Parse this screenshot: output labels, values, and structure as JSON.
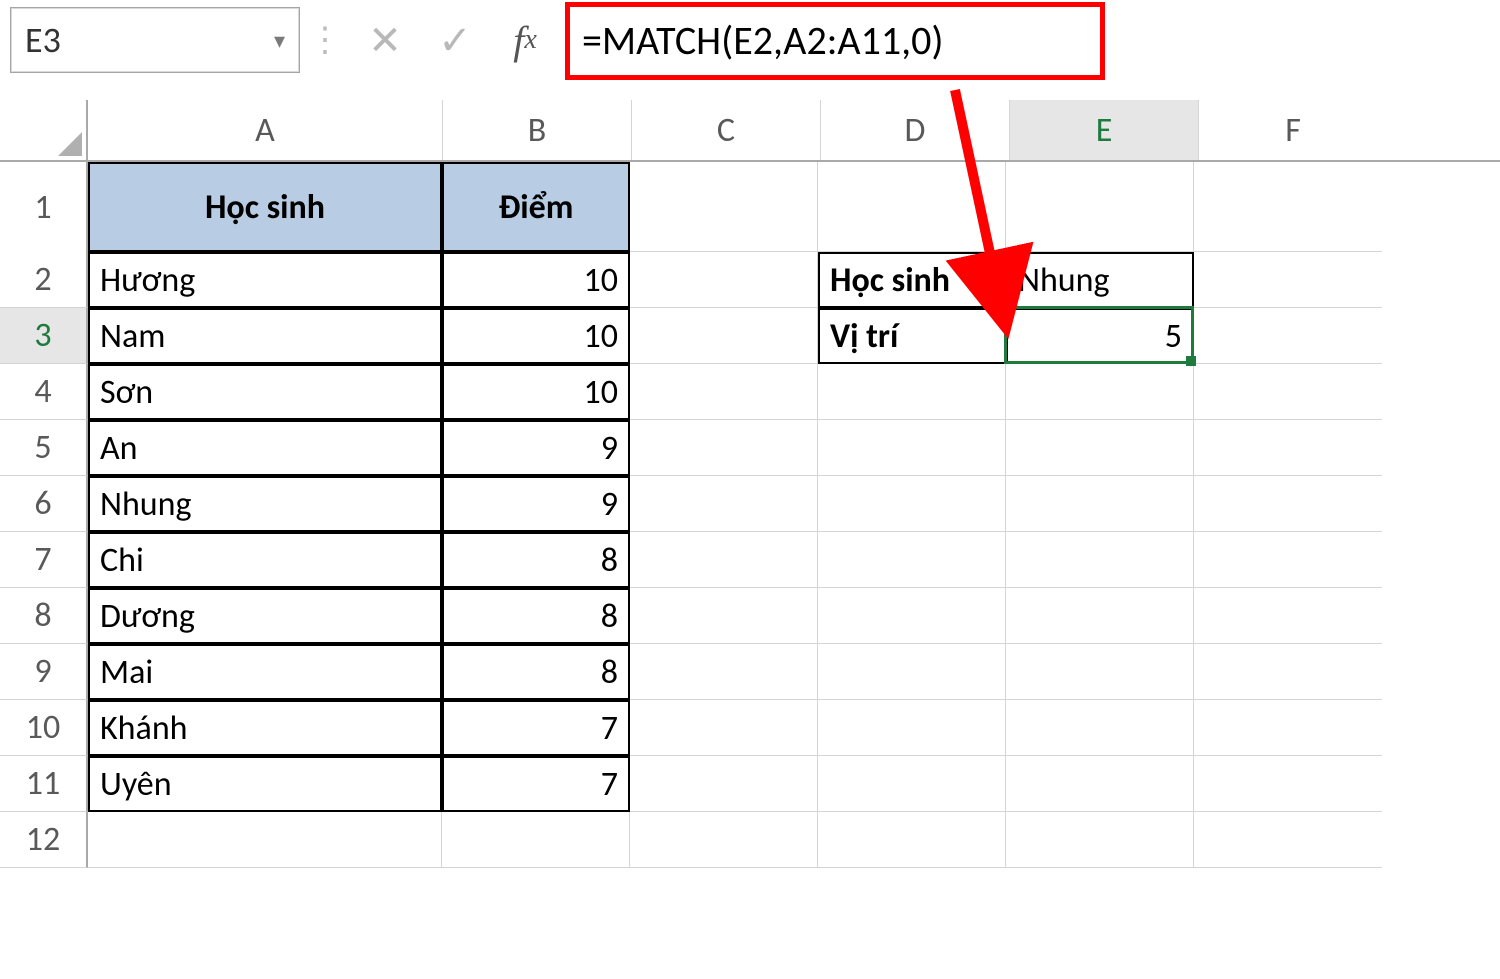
{
  "formula_bar": {
    "cell_ref": "E3",
    "formula": "=MATCH(E2,A2:A11,0)"
  },
  "columns": [
    "A",
    "B",
    "C",
    "D",
    "E",
    "F"
  ],
  "row_numbers": [
    "1",
    "2",
    "3",
    "4",
    "5",
    "6",
    "7",
    "8",
    "9",
    "10",
    "11",
    "12"
  ],
  "table_header": {
    "colA": "Học sinh",
    "colB": "Điểm"
  },
  "students": [
    {
      "name": "Hương",
      "score": "10"
    },
    {
      "name": "Nam",
      "score": "10"
    },
    {
      "name": "Sơn",
      "score": "10"
    },
    {
      "name": "An",
      "score": "9"
    },
    {
      "name": "Nhung",
      "score": "9"
    },
    {
      "name": "Chi",
      "score": "8"
    },
    {
      "name": "Dương",
      "score": "8"
    },
    {
      "name": "Mai",
      "score": "8"
    },
    {
      "name": "Khánh",
      "score": "7"
    },
    {
      "name": "Uyên",
      "score": "7"
    }
  ],
  "lookup": {
    "label_student": "Học sinh",
    "value_student": "Nhung",
    "label_position": "Vị trí",
    "value_position": "5"
  },
  "active_cell": "E3",
  "selected_row": "3",
  "selected_col": "E",
  "colors": {
    "header_fill": "#b8cce4",
    "select_green": "#1f7a3d",
    "annotation_red": "#ff0000"
  }
}
